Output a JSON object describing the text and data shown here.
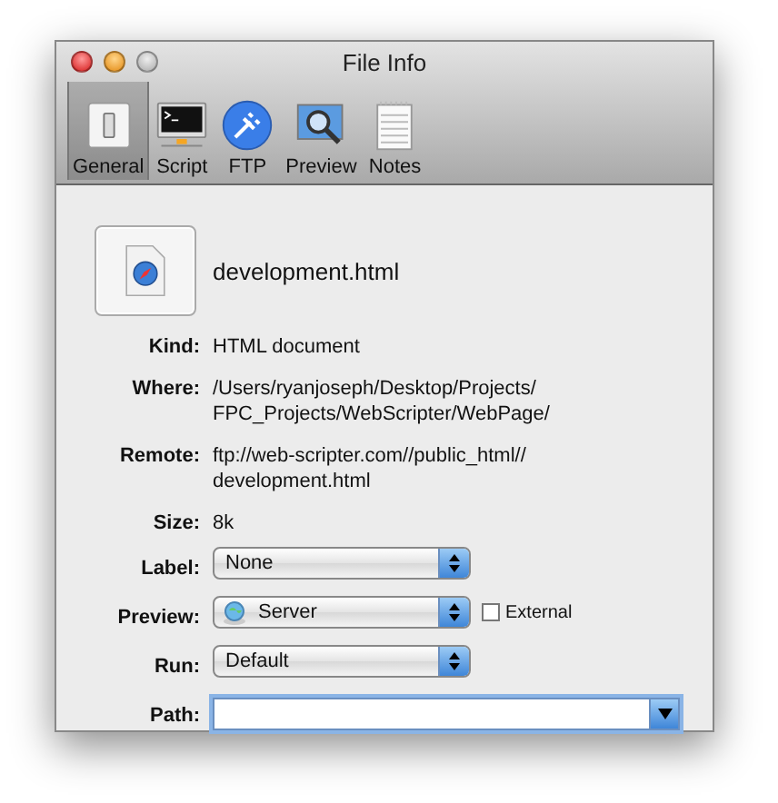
{
  "window": {
    "title": "File Info"
  },
  "toolbar": [
    {
      "label": "General",
      "selected": true
    },
    {
      "label": "Script",
      "selected": false
    },
    {
      "label": "FTP",
      "selected": false
    },
    {
      "label": "Preview",
      "selected": false
    },
    {
      "label": "Notes",
      "selected": false
    }
  ],
  "file": {
    "name": "development.html"
  },
  "fields": [
    {
      "kind": "text",
      "label": "Kind:",
      "lines": [
        "HTML document"
      ]
    },
    {
      "kind": "text",
      "label": "Where:",
      "lines": [
        "/Users/ryanjoseph/Desktop/Projects/",
        "FPC_Projects/WebScripter/WebPage/"
      ]
    },
    {
      "kind": "text",
      "label": "Remote:",
      "lines": [
        "ftp://web-scripter.com//public_html//",
        "development.html"
      ]
    },
    {
      "kind": "text",
      "label": "Size:",
      "lines": [
        "8k"
      ]
    },
    {
      "kind": "popup",
      "label": "Label:",
      "value": "None"
    },
    {
      "kind": "popup",
      "label": "Preview:",
      "value": "Server",
      "has_icon": true,
      "checkbox": {
        "label": "External",
        "checked": false
      }
    },
    {
      "kind": "popup",
      "label": "Run:",
      "value": "Default"
    },
    {
      "kind": "combo",
      "label": "Path:"
    }
  ]
}
